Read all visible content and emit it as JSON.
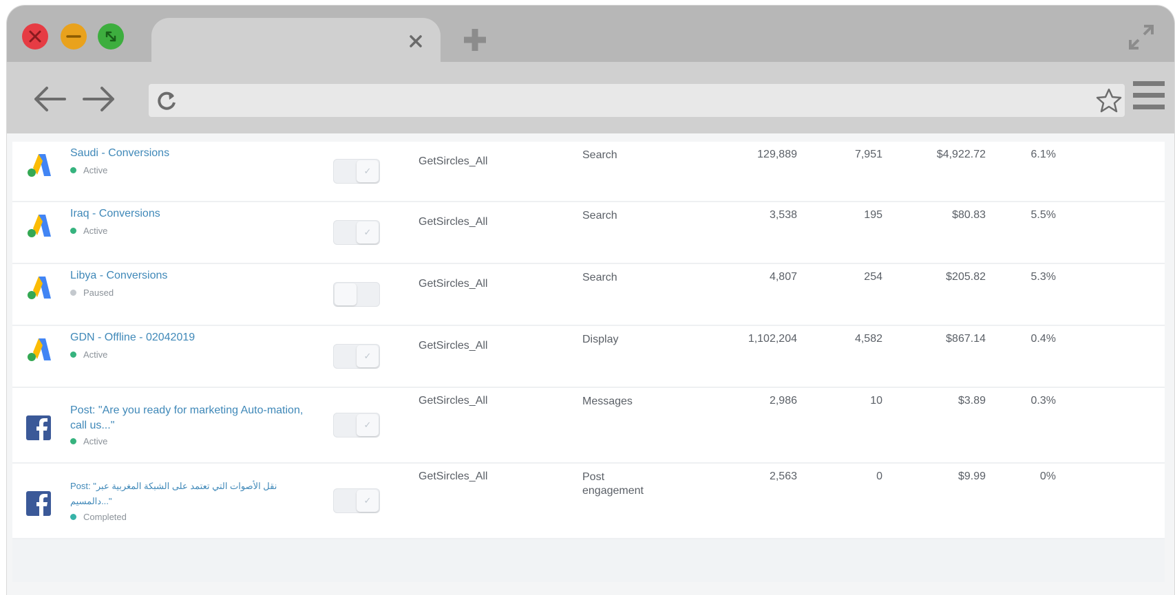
{
  "browser": {
    "icons": {
      "close_window": "close-window-icon",
      "minimize": "minimize-icon",
      "maximize": "maximize-icon",
      "tab_close": "close-icon",
      "new_tab": "plus-icon",
      "expand": "expand-icon",
      "back": "back-arrow-icon",
      "forward": "forward-arrow-icon",
      "reload": "reload-icon",
      "bookmark": "star-icon",
      "menu": "hamburger-menu-icon"
    },
    "colors": {
      "red": "#e63c44",
      "yellow": "#e9a21d",
      "green": "#3dae3e"
    }
  },
  "campaigns": [
    {
      "name": "Saudi - Conversions",
      "status": "Active",
      "status_color": "#36b37e",
      "platform": "google-ads",
      "enabled": true,
      "account": "GetSircles_All",
      "type": "Search",
      "impressions": "129,889",
      "clicks": "7,951",
      "cost": "$4,922.72",
      "ctr": "6.1%"
    },
    {
      "name": "Iraq - Conversions",
      "status": "Active",
      "status_color": "#36b37e",
      "platform": "google-ads",
      "enabled": true,
      "account": "GetSircles_All",
      "type": "Search",
      "impressions": "3,538",
      "clicks": "195",
      "cost": "$80.83",
      "ctr": "5.5%"
    },
    {
      "name": "Libya - Conversions",
      "status": "Paused",
      "status_color": "#c4c9ce",
      "platform": "google-ads",
      "enabled": false,
      "account": "GetSircles_All",
      "type": "Search",
      "impressions": "4,807",
      "clicks": "254",
      "cost": "$205.82",
      "ctr": "5.3%"
    },
    {
      "name": "GDN - Offline - 02042019",
      "status": "Active",
      "status_color": "#36b37e",
      "platform": "google-ads",
      "enabled": true,
      "account": "GetSircles_All",
      "type": "Display",
      "impressions": "1,102,204",
      "clicks": "4,582",
      "cost": "$867.14",
      "ctr": "0.4%"
    },
    {
      "name": "Post: \"Are you ready for marketing Auto-mation, call us...\"",
      "status": "Active",
      "status_color": "#36b37e",
      "platform": "facebook",
      "enabled": true,
      "account": "GetSircles_All",
      "type": "Messages",
      "impressions": "2,986",
      "clicks": "10",
      "cost": "$3.89",
      "ctr": "0.3%"
    },
    {
      "name": "Post: \"نقل الأصوات التي تعتمد على الشبكة المغربية عبر دالمسيم...\"",
      "status": "Completed",
      "status_color": "#36b3a8",
      "platform": "facebook",
      "enabled": true,
      "account": "GetSircles_All",
      "type": "Post engagement",
      "impressions": "2,563",
      "clicks": "0",
      "cost": "$9.99",
      "ctr": "0%"
    }
  ]
}
